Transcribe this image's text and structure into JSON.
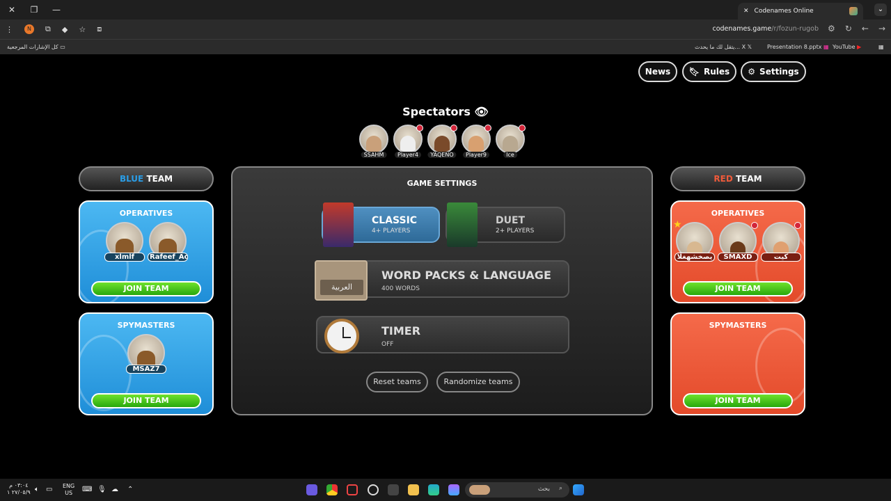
{
  "browser": {
    "tab_title": "Codenames Online",
    "url_host": "codenames.game",
    "url_path": "/r/fozun-rugob",
    "bookmarks": {
      "all_bookmarks": "كل الإشارات المرجعية",
      "item1": "يتقل لك ما يحدث... X",
      "item2": "Presentation 8.pptx",
      "item3": "YouTube"
    }
  },
  "nav": {
    "news": "News",
    "rules": "Rules",
    "settings": "Settings"
  },
  "spectators": {
    "title": "Spectators",
    "people": [
      {
        "name": "SSAHM",
        "badge": false
      },
      {
        "name": "Player4",
        "badge": true
      },
      {
        "name": "YAQENO",
        "badge": true
      },
      {
        "name": "Player9",
        "badge": true
      },
      {
        "name": "Ice",
        "badge": true
      }
    ]
  },
  "blue_team": {
    "color_word": "BLUE",
    "team_word": "TEAM",
    "operatives_title": "OPERATIVES",
    "operatives": [
      "xlmlf",
      "Rafeef_Ac"
    ],
    "spymasters_title": "SPYMASTERS",
    "spymasters": [
      "MSAZ7"
    ],
    "join_label": "JOIN TEAM",
    "color": "#2a9de6"
  },
  "red_team": {
    "color_word": "RED",
    "team_word": "TEAM",
    "operatives_title": "OPERATIVES",
    "operatives": [
      "يصخشهغلا",
      "SMAXD",
      "كيت"
    ],
    "spymasters_title": "SPYMASTERS",
    "join_label": "JOIN TEAM",
    "color": "#ef5a3a"
  },
  "game_settings": {
    "title": "GAME SETTINGS",
    "modes": [
      {
        "name": "CLASSIC",
        "sub": "4+ PLAYERS",
        "selected": true
      },
      {
        "name": "DUET",
        "sub": "2+ PLAYERS",
        "selected": false
      }
    ],
    "word_packs": {
      "title": "WORD PACKS & LANGUAGE",
      "sub": "400 WORDS",
      "pack_label": "العربية"
    },
    "timer": {
      "title": "TIMER",
      "sub": "OFF"
    },
    "reset_label": "Reset teams",
    "randomize_label": "Randomize teams"
  },
  "taskbar": {
    "time": "٠٣:٠٤ م",
    "date": "٢٧/٠٥/٩ ١",
    "lang1": "ENG",
    "lang2": "US",
    "search_placeholder": "بحث"
  }
}
